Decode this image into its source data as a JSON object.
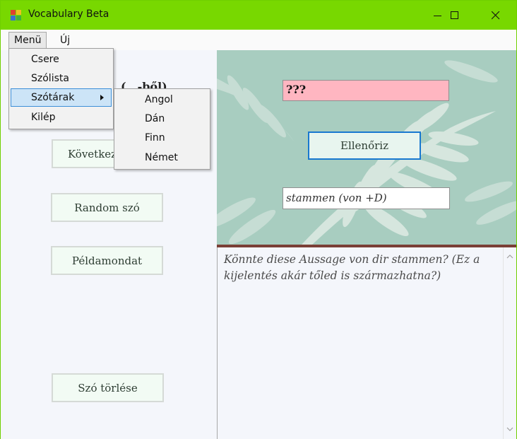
{
  "window": {
    "title": "Vocabulary Beta",
    "accent_color": "#78d800"
  },
  "menubar": {
    "items": [
      "Menü",
      "Új"
    ]
  },
  "menu_dropdown": {
    "items": [
      "Csere",
      "Szólista",
      "Szótárak",
      "Kilép"
    ]
  },
  "dictionaries_submenu": {
    "items": [
      "Angol",
      "Dán",
      "Finn",
      "Német"
    ]
  },
  "left_panel": {
    "direction_label_partial": "(…-ből)",
    "next_button": "Következő",
    "random_word_button": "Random szó",
    "example_sentence_button": "Példamondat",
    "delete_word_button": "Szó törlése"
  },
  "quiz": {
    "answer_value": "???",
    "answer_bg_color": "#ffb6c1",
    "check_button": "Ellenőriz",
    "hint_value": "stammen (von +D)"
  },
  "example_sentence": {
    "text": "Könnte diese Aussage von dir stammen? (Ez a kijelentés akár tőled is származhatna?)"
  }
}
